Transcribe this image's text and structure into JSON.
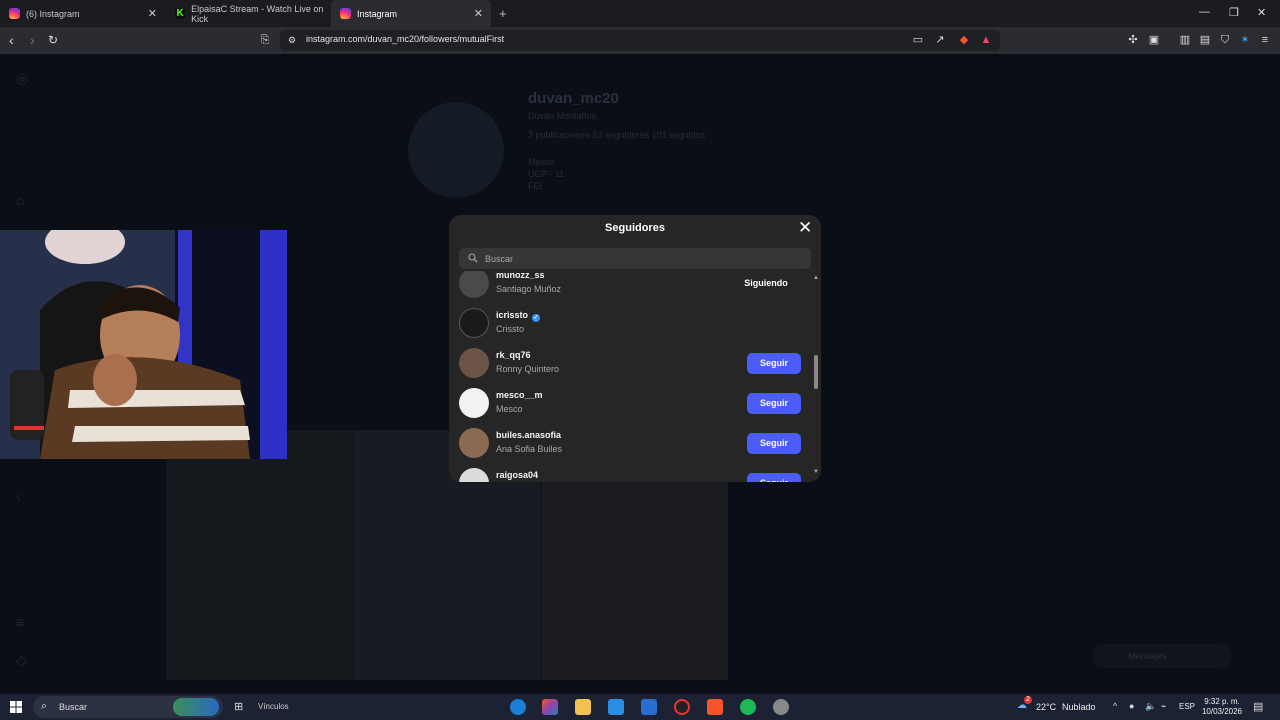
{
  "browser": {
    "tabs": [
      {
        "title": "(6) Instagram",
        "favicon": "instagram-icon",
        "active": false
      },
      {
        "title": "ElpaisaC Stream - Watch Live on Kick",
        "favicon": "kick-icon",
        "active": false
      },
      {
        "title": "Instagram",
        "favicon": "instagram-icon",
        "active": true
      }
    ],
    "new_tab": "+",
    "url": "instagram.com/duvan_mc20/followers/mutualFirst"
  },
  "profile": {
    "username": "duvan_mc20",
    "fullname": "Duvan Montaños",
    "stats": "3 publicaciones   53 seguidores   101 seguidos",
    "bio": "Mesco\nUCP - 11\nFEI"
  },
  "modal": {
    "title": "Seguidores",
    "search_placeholder": "Buscar",
    "followers": [
      {
        "username": "munozz_ss",
        "fullname": "Santiago Muñoz",
        "action": "Siguiendo",
        "verified": false,
        "avatar_color": "#4a4a4a"
      },
      {
        "username": "icrissto",
        "fullname": "Crissto",
        "action": "",
        "verified": true,
        "avatar_color": "#1a1a1a"
      },
      {
        "username": "rk_qq76",
        "fullname": "Ronny Quintero",
        "action": "Seguir",
        "verified": false,
        "avatar_color": "#6b5446"
      },
      {
        "username": "mesco__m",
        "fullname": "Mesco",
        "action": "Seguir",
        "verified": false,
        "avatar_color": "#f2f2f2"
      },
      {
        "username": "builes.anasofia",
        "fullname": "Ana Sofia Builes",
        "action": "Seguir",
        "verified": false,
        "avatar_color": "#8a6a52"
      },
      {
        "username": "raigosa04",
        "fullname": "",
        "action": "Seguir",
        "verified": false,
        "avatar_color": "#dcdcdc"
      }
    ]
  },
  "page_bg": {
    "messages": "Mensajes"
  },
  "taskbar": {
    "search_label": "Buscar",
    "links_label": "Vínculos",
    "weather_temp": "22°C",
    "weather_desc": "Nublado",
    "language": "ESP",
    "time": "9:32 p. m.",
    "date": "10/03/2026",
    "notification_count": "2"
  },
  "colors": {
    "follow_button": "#4a5df9",
    "modal_bg": "#262626",
    "page_bg": "#0a0e16"
  }
}
